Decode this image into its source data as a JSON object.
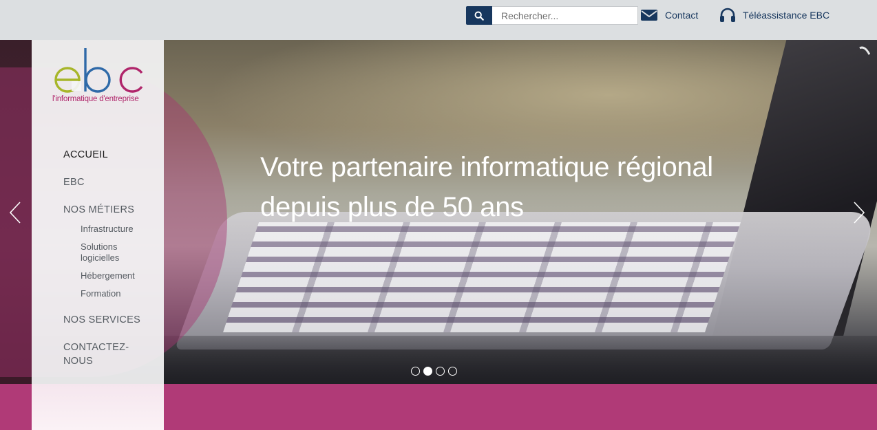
{
  "header": {
    "search": {
      "placeholder": "Rechercher..."
    },
    "contact_label": "Contact",
    "support_label": "Téléassistance EBC"
  },
  "logo": {
    "letters": "ebc",
    "tagline": "l'informatique d'entreprise",
    "colors": {
      "e": "#a7b62a",
      "b": "#2f6aa8",
      "c": "#b0266b"
    }
  },
  "sidebar": {
    "items": [
      {
        "label": "ACCUEIL",
        "active": true
      },
      {
        "label": "EBC"
      },
      {
        "label": "NOS MÉTIERS"
      },
      {
        "label": "NOS SERVICES"
      },
      {
        "label": "CONTACTEZ-",
        "label2": "NOUS"
      }
    ],
    "sub_items": [
      "Infrastructure",
      "Solutions",
      "logicielles",
      "Hébergement",
      "Formation"
    ]
  },
  "hero": {
    "title_line1": "Votre partenaire informatique régional",
    "title_line2": "depuis plus de 50 ans",
    "slides_total": 4,
    "active_slide": 2
  },
  "colors": {
    "brand_navy": "#17375e",
    "brand_pink": "#b03a77"
  }
}
